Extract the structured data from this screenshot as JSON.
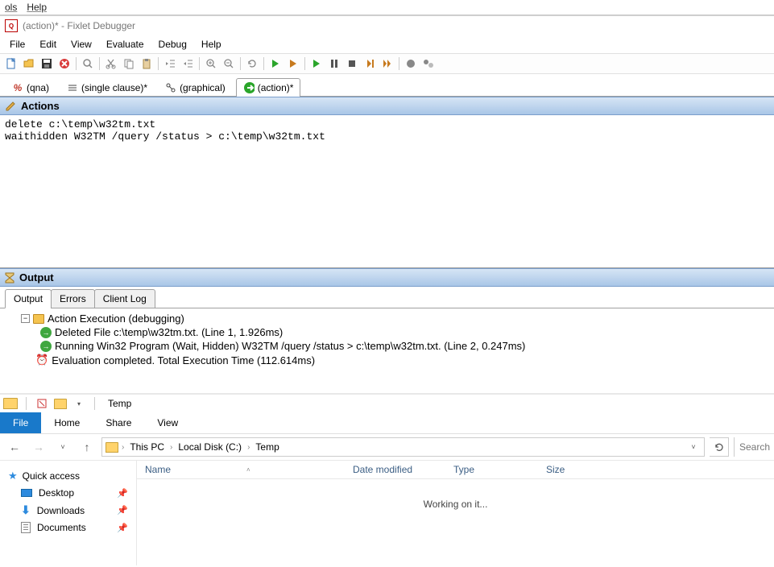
{
  "top_hint": {
    "item1": "ols",
    "item2": "Help"
  },
  "fixlet": {
    "title": "(action)* - Fixlet Debugger",
    "menu": [
      "File",
      "Edit",
      "View",
      "Evaluate",
      "Debug",
      "Help"
    ],
    "tabs": {
      "qna": "(qna)",
      "single": "(single clause)*",
      "graphical": "(graphical)",
      "action": "(action)*"
    },
    "actions_header": "Actions",
    "actions_text": "delete c:\\temp\\w32tm.txt\nwaithidden W32TM /query /status > c:\\temp\\w32tm.txt",
    "output_header": "Output",
    "output_tabs": {
      "output": "Output",
      "errors": "Errors",
      "clientlog": "Client Log"
    },
    "tree": {
      "root": "Action Execution (debugging)",
      "line1": "Deleted File c:\\temp\\w32tm.txt. (Line 1, 1.926ms)",
      "line2": "Running Win32 Program (Wait, Hidden) W32TM /query /status > c:\\temp\\w32tm.txt. (Line 2, 0.247ms)",
      "eval": "Evaluation completed.  Total Execution Time (112.614ms)"
    }
  },
  "explorer": {
    "title": "Temp",
    "ribbon": {
      "file": "File",
      "home": "Home",
      "share": "Share",
      "view": "View"
    },
    "breadcrumbs": [
      "This PC",
      "Local Disk (C:)",
      "Temp"
    ],
    "search_placeholder": "Search",
    "nav": {
      "quick_access": "Quick access",
      "desktop": "Desktop",
      "downloads": "Downloads",
      "documents": "Documents"
    },
    "columns": {
      "name": "Name",
      "date": "Date modified",
      "type": "Type",
      "size": "Size"
    },
    "status": "Working on it..."
  }
}
